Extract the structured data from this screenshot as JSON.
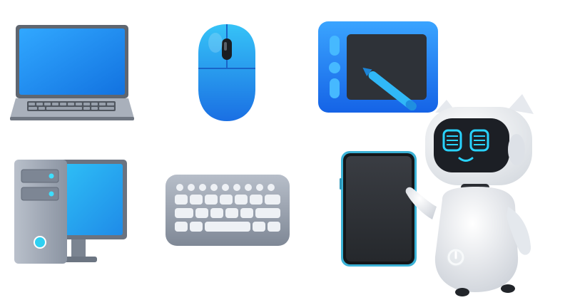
{
  "scene": {
    "icons": [
      "laptop-icon",
      "mouse-icon",
      "drawing-tablet-icon",
      "desktop-computer-icon",
      "keyboard-icon",
      "smartphone-icon",
      "robot-icon"
    ],
    "colors": {
      "screen_blue": "#1e9bf0",
      "accent_blue": "#2b8ff5",
      "device_grey": "#9ea6b3",
      "dark_screen": "#2f3237",
      "robot_white": "#f1f3f5",
      "robot_eyes": "#29d3ff"
    }
  }
}
